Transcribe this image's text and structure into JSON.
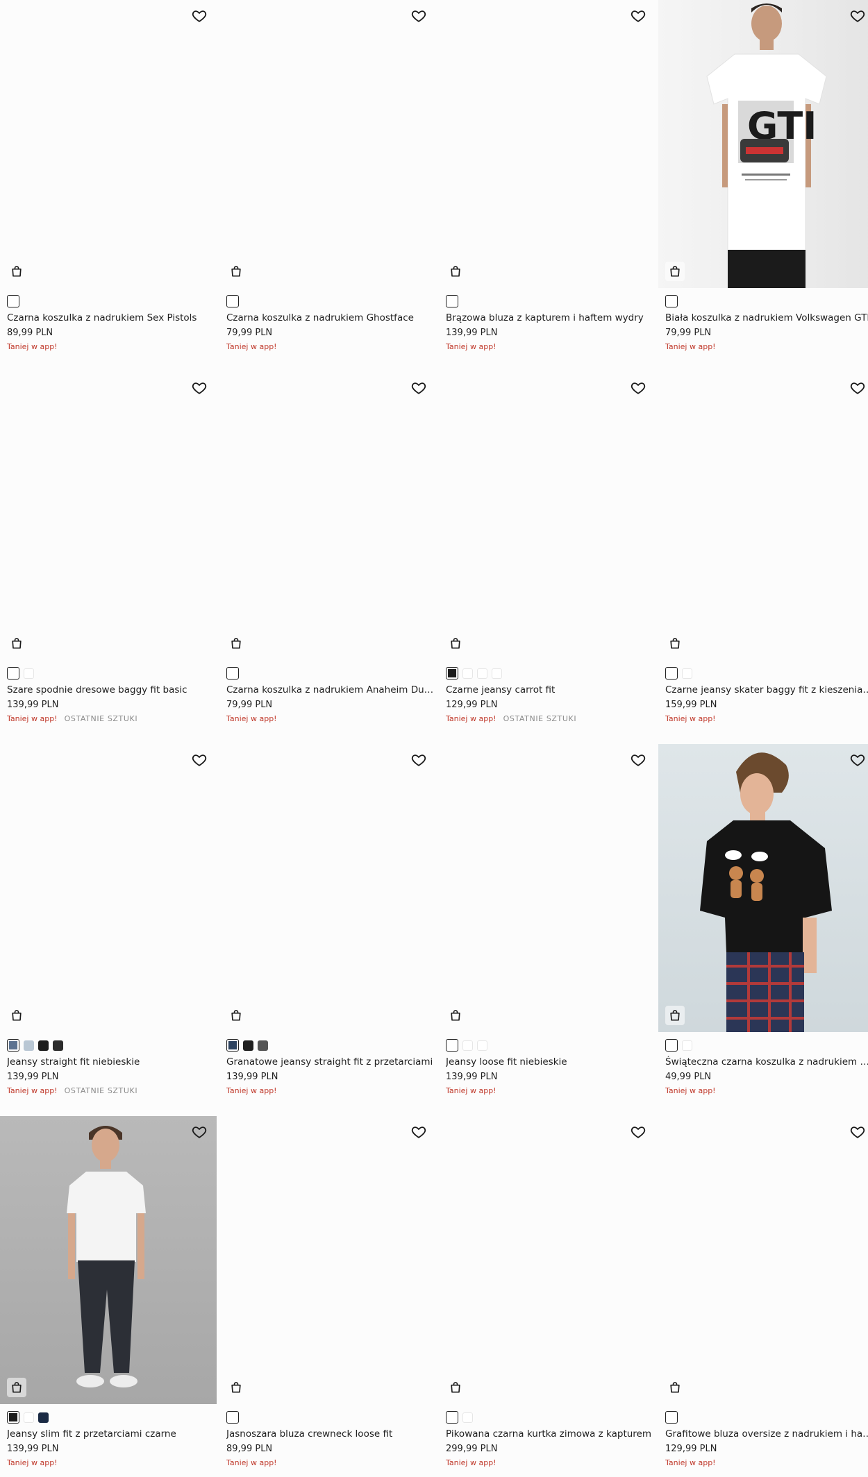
{
  "products": [
    {
      "name": "Czarna koszulka z nadrukiem Sex Pistols",
      "price": "89,99 PLN",
      "promo": "Taniej w app!",
      "badge": "",
      "photo": "",
      "swatches": [
        "#ffffff"
      ],
      "selected": 0
    },
    {
      "name": "Czarna koszulka z nadrukiem Ghostface",
      "price": "79,99 PLN",
      "promo": "Taniej w app!",
      "badge": "",
      "photo": "",
      "swatches": [
        "#ffffff"
      ],
      "selected": 0
    },
    {
      "name": "Brązowa bluza z kapturem i haftem wydry",
      "price": "139,99 PLN",
      "promo": "Taniej w app!",
      "badge": "",
      "photo": "",
      "swatches": [
        "#ffffff"
      ],
      "selected": 0
    },
    {
      "name": "Biała koszulka z nadrukiem Volkswagen GTI",
      "price": "79,99 PLN",
      "promo": "Taniej w app!",
      "badge": "",
      "photo": "shirt",
      "swatches": [
        "#ffffff"
      ],
      "selected": 0
    },
    {
      "name": "Szare spodnie dresowe baggy fit basic",
      "price": "139,99 PLN",
      "promo": "Taniej w app!",
      "badge": "OSTATNIE SZTUKI",
      "photo": "",
      "swatches": [
        "#ffffff",
        "#ffffff"
      ],
      "selected": 0
    },
    {
      "name": "Czarna koszulka z nadrukiem Anaheim Ducks",
      "price": "79,99 PLN",
      "promo": "Taniej w app!",
      "badge": "",
      "photo": "",
      "swatches": [
        "#ffffff"
      ],
      "selected": 0
    },
    {
      "name": "Czarne jeansy carrot fit",
      "price": "129,99 PLN",
      "promo": "Taniej w app!",
      "badge": "OSTATNIE SZTUKI",
      "photo": "",
      "swatches": [
        "#1c1c1c",
        "#ffffff",
        "#ffffff",
        "#ffffff"
      ],
      "selected": 0
    },
    {
      "name": "Czarne jeansy skater baggy fit z kieszeniami cargo",
      "price": "159,99 PLN",
      "promo": "Taniej w app!",
      "badge": "",
      "photo": "",
      "swatches": [
        "#ffffff",
        "#ffffff"
      ],
      "selected": 0
    },
    {
      "name": "Jeansy straight fit niebieskie",
      "price": "139,99 PLN",
      "promo": "Taniej w app!",
      "badge": "OSTATNIE SZTUKI",
      "photo": "",
      "swatches": [
        "#5d7391",
        "#b9c7d4",
        "#1c1c1c",
        "#2b2b2b"
      ],
      "selected": 0
    },
    {
      "name": "Granatowe jeansy straight fit z przetarciami",
      "price": "139,99 PLN",
      "promo": "Taniej w app!",
      "badge": "",
      "photo": "",
      "swatches": [
        "#2e4360",
        "#1f1f1f",
        "#555555"
      ],
      "selected": 0
    },
    {
      "name": "Jeansy loose fit niebieskie",
      "price": "139,99 PLN",
      "promo": "Taniej w app!",
      "badge": "",
      "photo": "",
      "swatches": [
        "#ffffff",
        "#ffffff",
        "#ffffff"
      ],
      "selected": 0
    },
    {
      "name": "Świąteczna czarna koszulka z nadrukiem pierników",
      "price": "49,99 PLN",
      "promo": "Taniej w app!",
      "badge": "",
      "photo": "xmas",
      "swatches": [
        "#ffffff",
        "#ffffff"
      ],
      "selected": 0
    },
    {
      "name": "Jeansy slim fit z przetarciami czarne",
      "price": "139,99 PLN",
      "promo": "Taniej w app!",
      "badge": "",
      "photo": "jeans",
      "swatches": [
        "#1c1c1c",
        "#ffffff",
        "#1a2a44"
      ],
      "selected": 0
    },
    {
      "name": "Jasnoszara bluza crewneck loose fit",
      "price": "89,99 PLN",
      "promo": "Taniej w app!",
      "badge": "",
      "photo": "",
      "swatches": [
        "#ffffff"
      ],
      "selected": 0
    },
    {
      "name": "Pikowana czarna kurtka zimowa z kapturem",
      "price": "299,99 PLN",
      "promo": "Taniej w app!",
      "badge": "",
      "photo": "",
      "swatches": [
        "#ffffff",
        "#ffffff"
      ],
      "selected": 0
    },
    {
      "name": "Grafitowe bluza oversize z nadrukiem i haftem",
      "price": "129,99 PLN",
      "promo": "Taniej w app!",
      "badge": "",
      "photo": "",
      "swatches": [
        "#ffffff"
      ],
      "selected": 0
    }
  ],
  "icons": {
    "favorite": "heart-icon",
    "cart": "shopping-bag-icon"
  },
  "colors": {
    "promo": "#c0392b",
    "badge": "#8a8a8a",
    "text": "#1f1f1f"
  }
}
